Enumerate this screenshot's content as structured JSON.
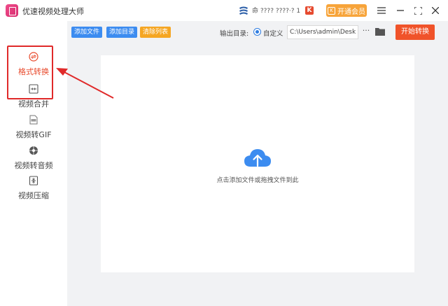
{
  "app": {
    "title": "优速视频处理大师"
  },
  "titlebar": {
    "promo_text": "命 ???? ????·? 1",
    "k_badge": "K",
    "vip_label": "开通会员",
    "vip_icon": "K"
  },
  "sidebar": {
    "items": [
      {
        "label": "格式转换",
        "icon": "convert-icon",
        "active": true
      },
      {
        "label": "视频合并",
        "icon": "merge-icon"
      },
      {
        "label": "视频转GIF",
        "icon": "gif-icon"
      },
      {
        "label": "视频转音频",
        "icon": "audio-icon"
      },
      {
        "label": "视频压缩",
        "icon": "compress-icon"
      }
    ]
  },
  "toolbar": {
    "add_file": "添加文件",
    "add_dir": "添加目录",
    "clear_list": "清除列表",
    "output_label": "输出目录:",
    "custom_label": "自定义",
    "output_path": "C:\\Users\\admin\\Deskto",
    "more": "···",
    "start": "开始转换"
  },
  "main": {
    "drop_hint": "点击添加文件或拖拽文件到此"
  },
  "colors": {
    "accent": "#3c8cf0",
    "start": "#f0532a",
    "highlight": "#e02a2a",
    "vip": "#f7a43a"
  }
}
